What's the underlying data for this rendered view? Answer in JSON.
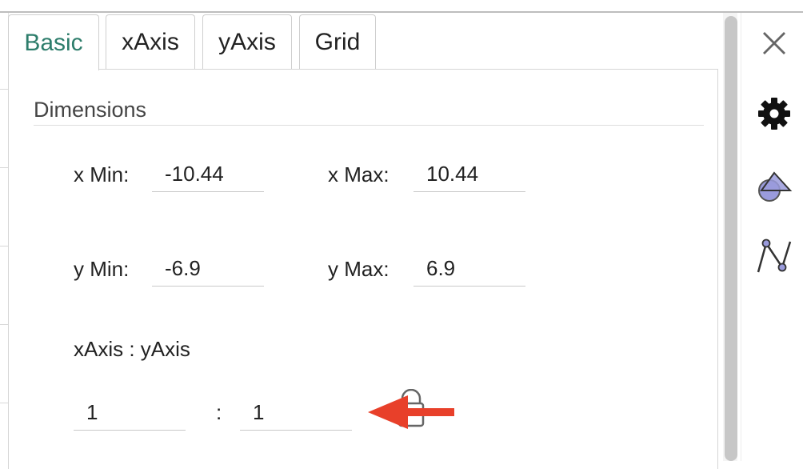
{
  "tabs": [
    "Basic",
    "xAxis",
    "yAxis",
    "Grid"
  ],
  "section": {
    "title": "Dimensions"
  },
  "dimensions": {
    "x_min_label": "x Min:",
    "x_min_value": "-10.44",
    "x_max_label": "x Max:",
    "x_max_value": "10.44",
    "y_min_label": "y Min:",
    "y_min_value": "-6.9",
    "y_max_label": "y Max:",
    "y_max_value": "6.9"
  },
  "ratio": {
    "label": "xAxis : yAxis",
    "x_value": "1",
    "separator": ":",
    "y_value": "1"
  },
  "sidebar": {
    "icons": [
      "close-icon",
      "gear-icon",
      "shapes-icon",
      "graph-icon"
    ]
  },
  "colors": {
    "active_tab": "#2d7d6b",
    "arrow": "#e8402a",
    "icon_fill": "#9a9bdc"
  }
}
